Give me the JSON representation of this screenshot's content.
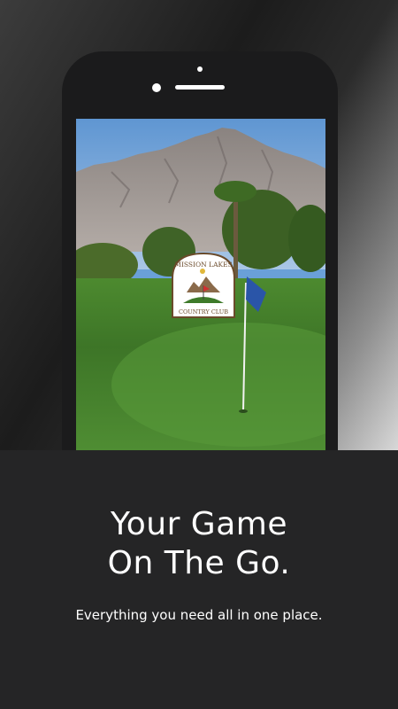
{
  "headline": {
    "line1": "Your Game",
    "line2": "On The Go."
  },
  "subheadline": "Everything you need all in one place.",
  "logo": {
    "top_text": "MISSION LAKES",
    "bottom_text": "COUNTRY CLUB"
  },
  "colors": {
    "panel": "#252526",
    "phone_body": "#1b1b1c",
    "text": "#ffffff",
    "grass": "#3f7a2c",
    "sky": "#6aa0d8",
    "flag": "#2a55a8"
  },
  "icons": {
    "camera": "camera-icon",
    "speaker": "speaker-icon",
    "flag": "golf-flag-icon"
  }
}
